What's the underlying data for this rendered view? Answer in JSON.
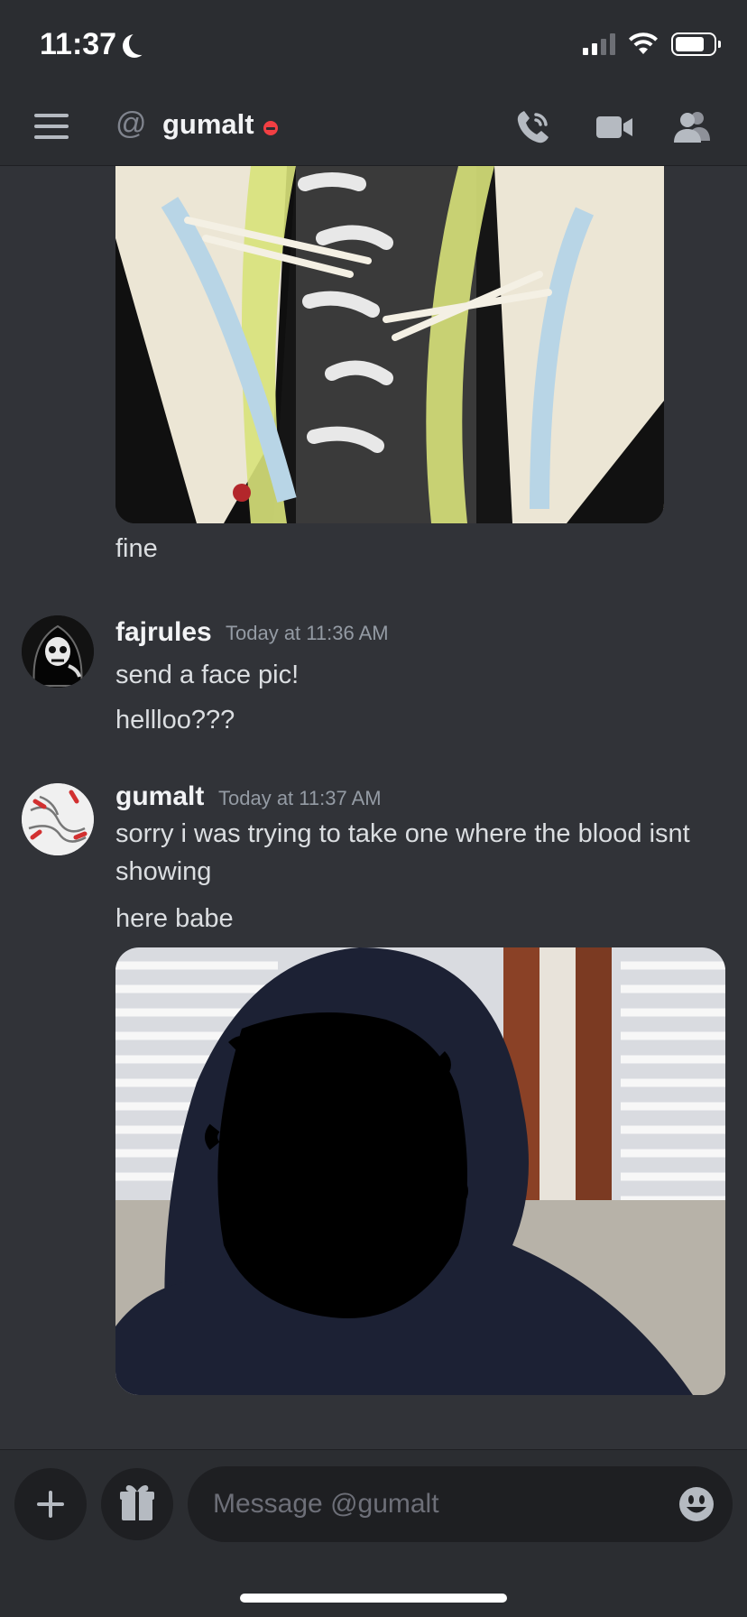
{
  "status_bar": {
    "time": "11:37"
  },
  "header": {
    "title": "gumalt",
    "at_symbol": "@"
  },
  "messages": {
    "first_caption": "fine",
    "m2": {
      "username": "fajrules",
      "timestamp": "Today at 11:36 AM",
      "lines": [
        "send a face pic!",
        "hellloo???"
      ]
    },
    "m3": {
      "username": "gumalt",
      "timestamp": "Today at 11:37 AM",
      "line1a": "sorry i was trying to take one where the blood isnt",
      "line1b": "showing",
      "line2": "here babe"
    }
  },
  "composer": {
    "placeholder": "Message @gumalt"
  },
  "colors": {
    "background": "#313338",
    "header": "#2b2d31",
    "input": "#1e1f22",
    "dnd": "#f23f43"
  },
  "icons": [
    "hamburger-icon",
    "at-icon",
    "call-icon",
    "video-icon",
    "members-icon",
    "plus-icon",
    "gift-icon",
    "emoji-icon"
  ]
}
